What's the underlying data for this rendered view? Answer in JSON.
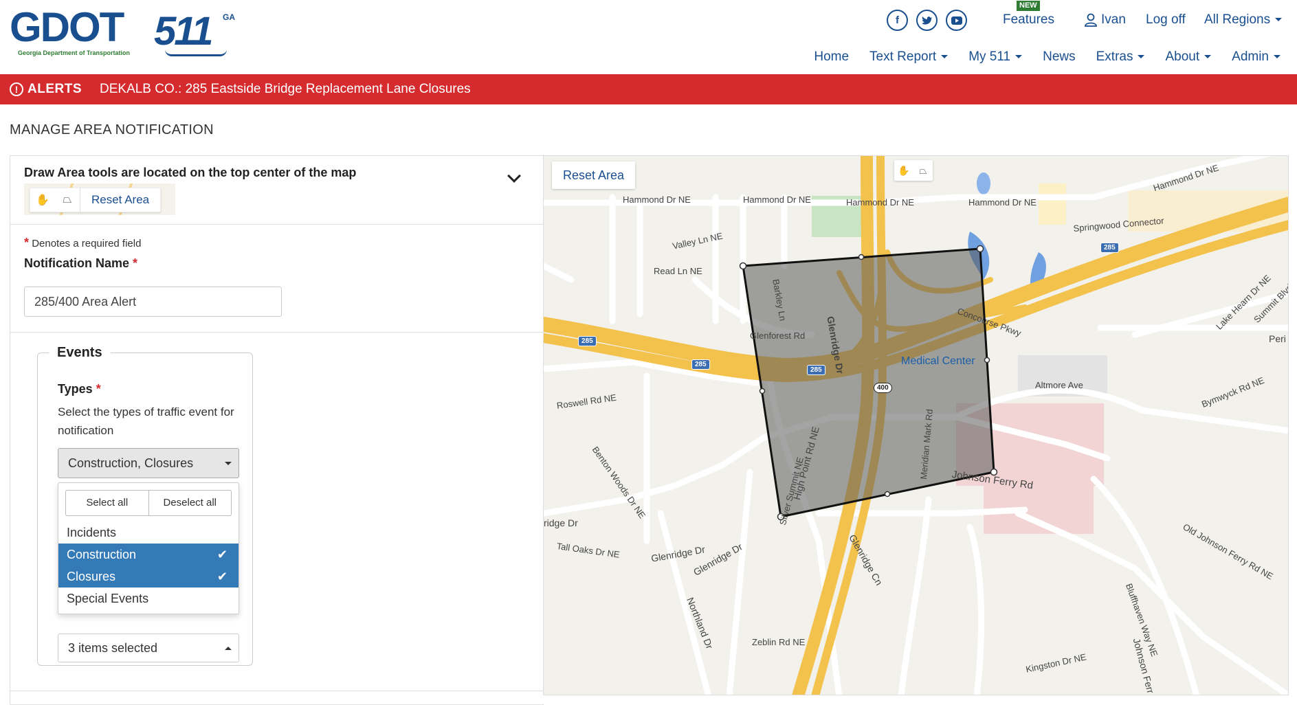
{
  "header": {
    "logo_text": "GDOT",
    "logo_subtitle": "Georgia Department of Transportation",
    "logo_511": "511",
    "logo_ga": "GA",
    "social": [
      "facebook-icon",
      "twitter-icon",
      "youtube-icon"
    ],
    "new_badge": "NEW",
    "features": "Features",
    "user": "Ivan",
    "logoff": "Log off",
    "regions": "All Regions",
    "nav": [
      "Home",
      "Text Report",
      "My 511",
      "News",
      "Extras",
      "About",
      "Admin"
    ]
  },
  "alerts": {
    "label": "ALERTS",
    "text": "DEKALB CO.: 285 Eastside Bridge Replacement Lane Closures"
  },
  "page": {
    "title": "MANAGE AREA NOTIFICATION"
  },
  "form": {
    "draw_hint": "Draw Area tools are located on the top center of the map",
    "reset_area": "Reset Area",
    "required_note": "Denotes a required field",
    "notification_name_label": "Notification Name",
    "notification_name_value": "285/400 Area Alert",
    "events_legend": "Events",
    "types_label": "Types",
    "types_desc": "Select the types of traffic event for notification",
    "types_selected": "Construction, Closures",
    "select_all": "Select all",
    "deselect_all": "Deselect all",
    "options": [
      {
        "label": "Incidents",
        "selected": false
      },
      {
        "label": "Construction",
        "selected": true
      },
      {
        "label": "Closures",
        "selected": true
      },
      {
        "label": "Special Events",
        "selected": false
      }
    ],
    "second_select": "3 items selected"
  },
  "map": {
    "reset_area": "Reset Area",
    "labels": {
      "hammond1": "Hammond Dr NE",
      "hammond2": "Hammond Dr NE",
      "hammond3": "Hammond Dr NE",
      "hammond4": "Hammond Dr NE",
      "hammond5": "Hammond Dr NE",
      "springwood": "Springwood Connector",
      "valley": "Valley Ln NE",
      "read": "Read Ln NE",
      "glenforest": "Glenforest Rd",
      "roswell": "Roswell Rd NE",
      "glenridge": "Glenridge Dr",
      "glenridge2": "Glenridge Dr",
      "glenridge3": "Glenridge Dr",
      "glenridge_cn": "Glenridge Cn",
      "concourse": "Concourse Pkwy",
      "altmore": "Altmore Ave",
      "johnson": "Johnson Ferry Rd",
      "johnson2": "Johnson Ferr",
      "tall_oaks": "Tall Oaks Dr NE",
      "high_point": "High Point Rd NE",
      "northland": "Northland Dr",
      "zeblin": "Zeblin Rd NE",
      "bluffhaven": "Bluffhaven Way NE",
      "kingston": "Kingston Dr NE",
      "old_johnson": "Old Johnson Ferry Rd NE",
      "bymwyck": "Bymwyck Rd NE",
      "lake_hearn": "Lake Hearn Dr NE",
      "summit": "Summit Blvd NE",
      "peri": "Peri",
      "ridge_dr": "ridge Dr",
      "benton": "Benton Woods Dr NE",
      "meridian": "Meridian Mark Rd",
      "silver_summit": "Silver Summit NE",
      "barkley": "Barkley Ln",
      "medical_center": "Medical Center",
      "shield_285": "285",
      "shield_400": "400"
    }
  },
  "colors": {
    "brand_blue": "#1a4f8f",
    "alert_red": "#d52b2e",
    "select_blue": "#337ab7",
    "highway": "#f3c24d"
  }
}
